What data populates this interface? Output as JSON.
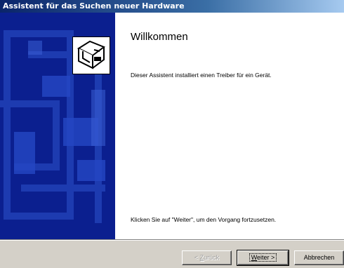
{
  "window": {
    "title": "Assistent für das Suchen neuer Hardware"
  },
  "page": {
    "heading": "Willkommen",
    "intro": "Dieser Assistent installiert einen Treiber für ein Gerät.",
    "hint": "Klicken Sie auf \"Weiter\", um den Vorgang fortzusetzen."
  },
  "buttons": {
    "back": {
      "label_prefix": "< ",
      "label_accel": "Z",
      "label_rest": "urück"
    },
    "next": {
      "label_accel": "W",
      "label_rest": "eiter >"
    },
    "cancel": {
      "label": "Abbrechen"
    }
  },
  "icons": {
    "wizard": "hardware-wizard-icon"
  }
}
